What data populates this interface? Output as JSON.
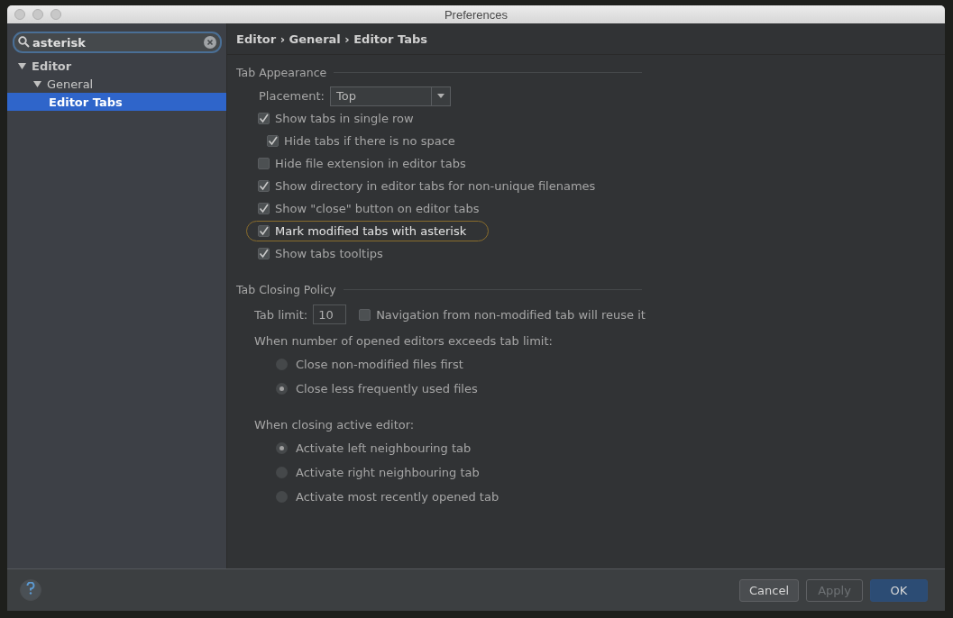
{
  "window": {
    "title": "Preferences"
  },
  "search": {
    "value": "asterisk"
  },
  "sidebar": {
    "items": [
      {
        "label": "Editor",
        "expanded": true,
        "selected": false,
        "children": [
          {
            "label": "General",
            "expanded": true,
            "selected": false,
            "children": [
              {
                "label": "Editor Tabs",
                "selected": true
              }
            ]
          }
        ]
      }
    ]
  },
  "breadcrumb": "Editor › General › Editor Tabs",
  "tab_appearance": {
    "title": "Tab Appearance",
    "placement": {
      "label": "Placement:",
      "value": "Top"
    },
    "options": [
      {
        "label": "Show tabs in single row",
        "checked": true,
        "highlighted": false,
        "children": [
          {
            "label": "Hide tabs if there is no space",
            "checked": true,
            "highlighted": false
          }
        ]
      },
      {
        "label": "Hide file extension in editor tabs",
        "checked": false,
        "highlighted": false
      },
      {
        "label": "Show directory in editor tabs for non-unique filenames",
        "checked": true,
        "highlighted": false
      },
      {
        "label": "Show \"close\" button on editor tabs",
        "checked": true,
        "highlighted": false
      },
      {
        "label": "Mark modified tabs with asterisk",
        "checked": true,
        "highlighted": true
      },
      {
        "label": "Show tabs tooltips",
        "checked": true,
        "highlighted": false
      }
    ]
  },
  "tab_closing_policy": {
    "title": "Tab Closing Policy",
    "tab_limit": {
      "label": "Tab limit:",
      "value": "10"
    },
    "reuse": {
      "label": "Navigation from non-modified tab will reuse it",
      "checked": false
    },
    "groups": [
      {
        "label": "When number of opened editors exceeds tab limit:",
        "options": [
          {
            "label": "Close non-modified files first",
            "selected": false
          },
          {
            "label": "Close less frequently used files",
            "selected": true
          }
        ]
      },
      {
        "label": "When closing active editor:",
        "options": [
          {
            "label": "Activate left neighbouring tab",
            "selected": true
          },
          {
            "label": "Activate right neighbouring tab",
            "selected": false
          },
          {
            "label": "Activate most recently opened tab",
            "selected": false
          }
        ]
      }
    ]
  },
  "buttons": [
    {
      "label": "Cancel",
      "kind": "normal"
    },
    {
      "label": "Apply",
      "kind": "disabled"
    },
    {
      "label": "OK",
      "kind": "default"
    }
  ]
}
